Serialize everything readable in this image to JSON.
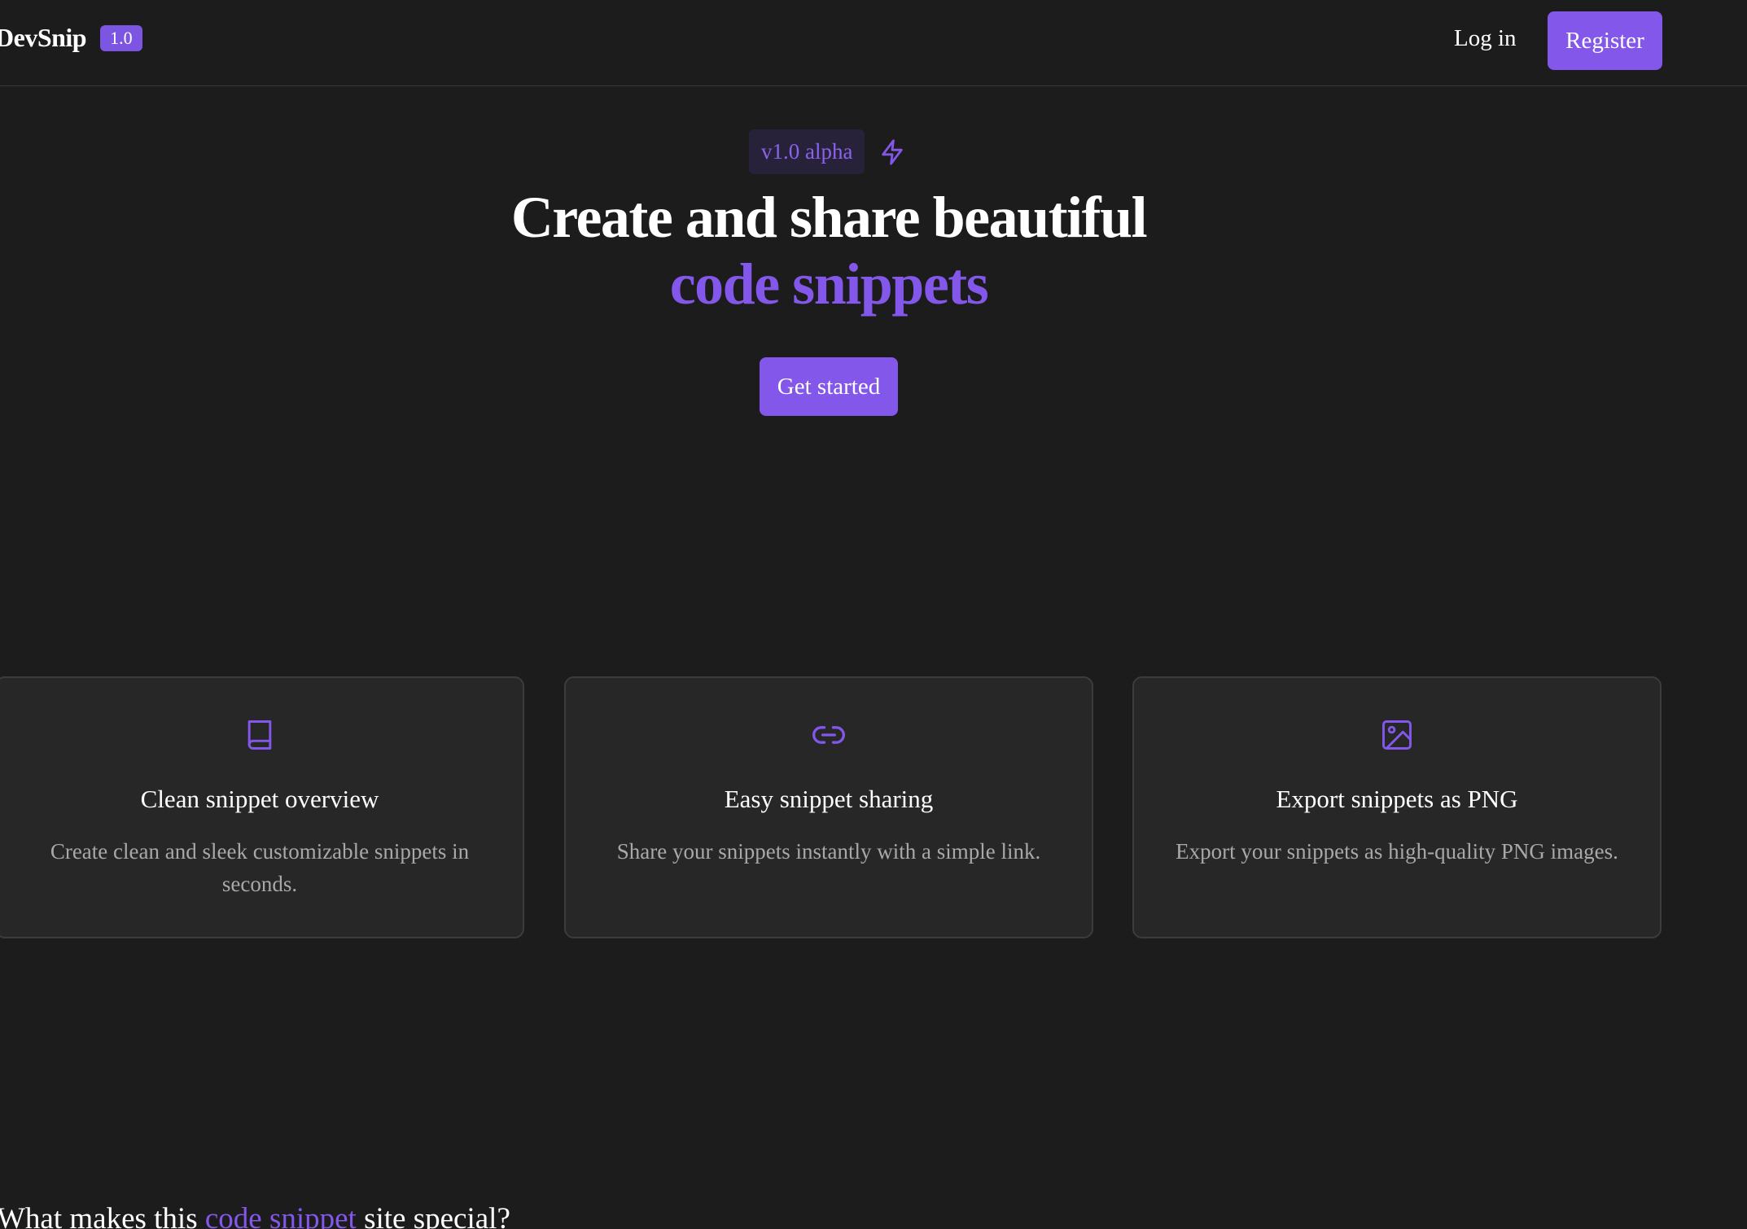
{
  "navbar": {
    "brand": "DevSnip",
    "brand_badge": "1.0",
    "login_label": "Log in",
    "register_label": "Register"
  },
  "hero": {
    "version_badge": "v1.0 alpha",
    "version_icon": "lightning-bolt-icon",
    "title_line1": "Create and share beautiful",
    "title_line2": "code snippets",
    "cta_label": "Get started"
  },
  "features": [
    {
      "icon": "book-icon",
      "title": "Clean snippet overview",
      "description": "Create clean and sleek customizable snippets in seconds."
    },
    {
      "icon": "link-icon",
      "title": "Easy snippet sharing",
      "description": "Share your snippets instantly with a simple link."
    },
    {
      "icon": "image-icon",
      "title": "Export snippets as PNG",
      "description": "Export your snippets as high-quality PNG images."
    }
  ],
  "section": {
    "heading_before": "What makes this ",
    "heading_accent": "code snippet",
    "heading_after": " site special?"
  },
  "colors": {
    "background": "#1c1c1c",
    "accent": "#8357ea",
    "card_background": "#272727",
    "muted_text": "#a8a8a8"
  }
}
